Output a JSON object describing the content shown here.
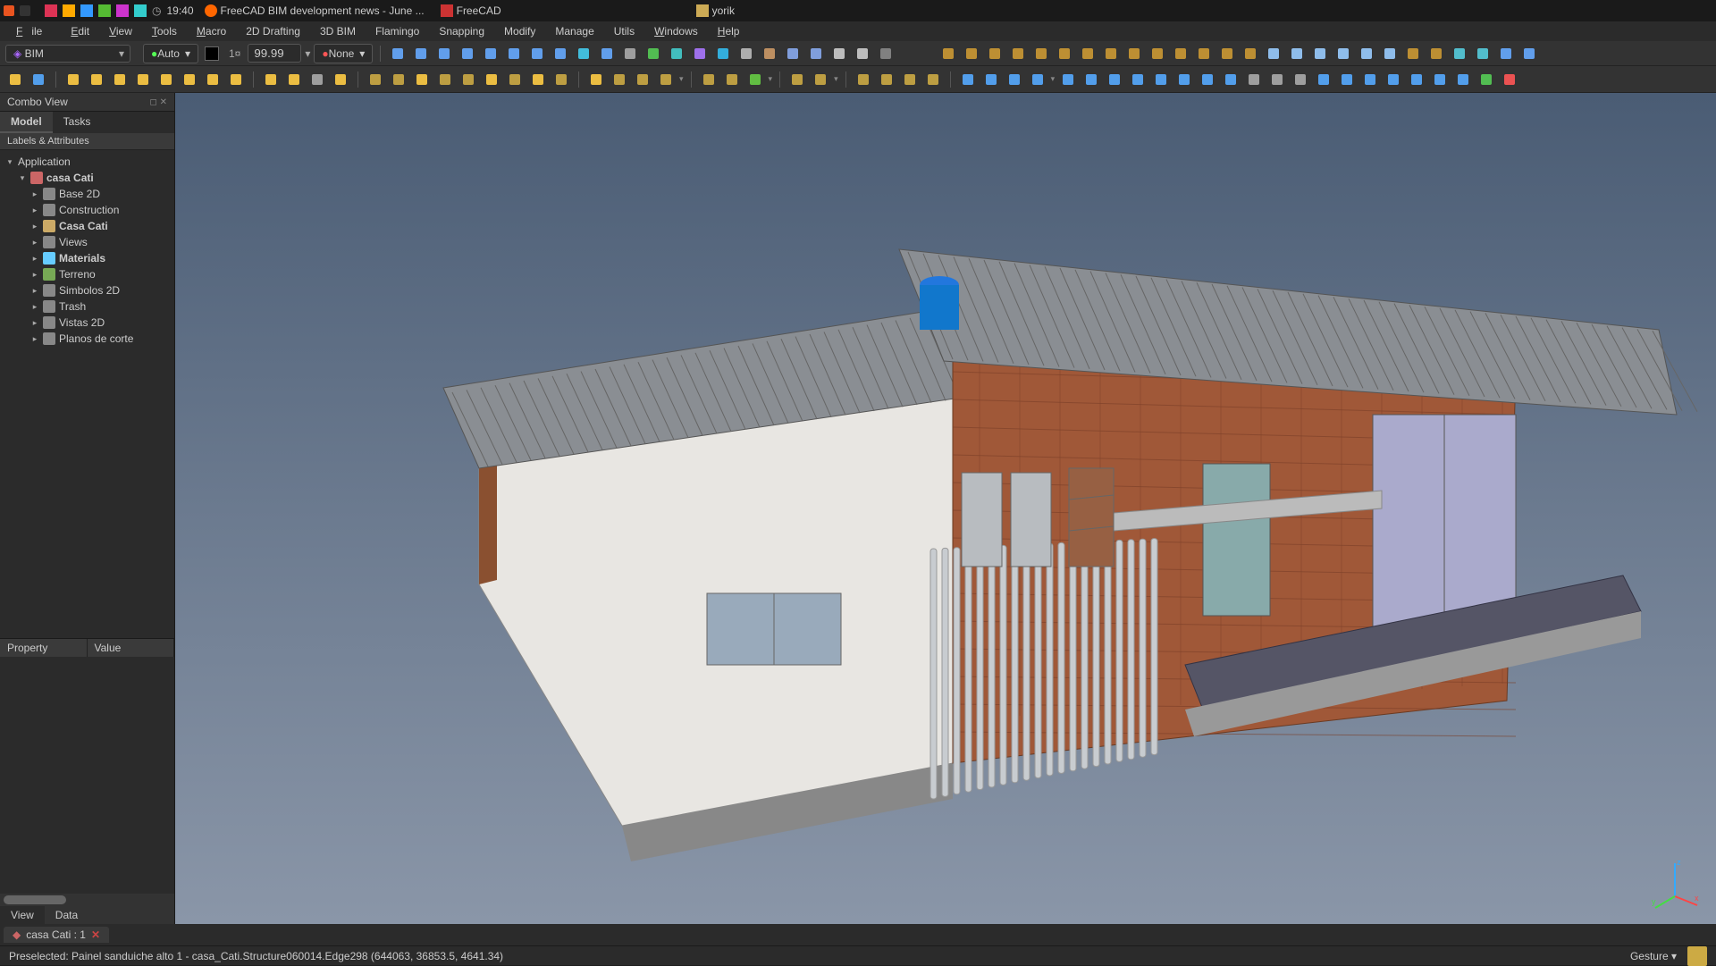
{
  "titlebar": {
    "time": "19:40",
    "tabs": [
      {
        "icon": "firefox",
        "label": "FreeCAD BIM development news - June ..."
      },
      {
        "icon": "freecad",
        "label": "FreeCAD"
      },
      {
        "icon": "folder",
        "label": "yorik"
      }
    ]
  },
  "menubar": [
    "File",
    "Edit",
    "View",
    "Tools",
    "Macro",
    "2D Drafting",
    "3D BIM",
    "Flamingo",
    "Snapping",
    "Modify",
    "Manage",
    "Utils",
    "Windows",
    "Help"
  ],
  "toolbar1": {
    "workbench": "BIM",
    "auto": "Auto",
    "precision": "99.99",
    "none": "None"
  },
  "combo_view": {
    "title": "Combo View",
    "tabs": [
      "Model",
      "Tasks"
    ],
    "active_tab": 0,
    "section": "Labels & Attributes",
    "root": "Application",
    "tree": [
      {
        "label": "casa Cati",
        "depth": 1,
        "expanded": true,
        "icon": "doc",
        "bold": true
      },
      {
        "label": "Base 2D",
        "depth": 2,
        "expanded": false,
        "icon": "folder"
      },
      {
        "label": "Construction",
        "depth": 2,
        "expanded": false,
        "icon": "folder"
      },
      {
        "label": "Casa Cati",
        "depth": 2,
        "expanded": false,
        "icon": "building",
        "bold": true
      },
      {
        "label": "Views",
        "depth": 2,
        "expanded": false,
        "icon": "folder"
      },
      {
        "label": "Materials",
        "depth": 2,
        "expanded": false,
        "icon": "material",
        "bold": true
      },
      {
        "label": "Terreno",
        "depth": 2,
        "expanded": false,
        "icon": "terrain"
      },
      {
        "label": "Simbolos 2D",
        "depth": 2,
        "expanded": false,
        "icon": "folder"
      },
      {
        "label": "Trash",
        "depth": 2,
        "expanded": false,
        "icon": "folder"
      },
      {
        "label": "Vistas 2D",
        "depth": 2,
        "expanded": false,
        "icon": "folder"
      },
      {
        "label": "Planos de corte",
        "depth": 2,
        "expanded": false,
        "icon": "folder"
      }
    ],
    "prop_headers": [
      "Property",
      "Value"
    ],
    "prop_tabs": [
      "View",
      "Data"
    ]
  },
  "doc_tab": {
    "label": "casa Cati : 1"
  },
  "statusbar": {
    "message": "Preselected: Painel sanduiche alto 1 - casa_Cati.Structure060014.Edge298 (644063, 36853.5, 4641.34)",
    "nav_mode": "Gesture"
  },
  "toolbar_icons_row1": [
    "grid",
    "axis",
    "workplane",
    "cube-view",
    "top-view",
    "front-view",
    "side-view",
    "iso-view",
    "globe",
    "circ",
    "cross-small",
    "fit-all",
    "section-box",
    "layer",
    "color-fill",
    "wrench",
    "package",
    "stack",
    "grid2",
    "file-alt",
    "save-alt",
    "toggle",
    "blank",
    "blank",
    "snap-end",
    "snap-mid",
    "snap-cen",
    "snap-ang",
    "snap-int",
    "snap-perp",
    "snap-ext",
    "snap-par",
    "snap-spec",
    "snap-near",
    "snap-ortho",
    "snap-grid",
    "snap-wp",
    "snap-dim",
    "guide1",
    "guide2",
    "guide3",
    "guide4",
    "guide5",
    "guide6",
    "ruler",
    "ruler2",
    "angle-snap",
    "grid-toggle",
    "clip1",
    "clip2"
  ],
  "toolbar_icons_row2": [
    "new-file",
    "open-file",
    "sep",
    "line",
    "wire",
    "circle",
    "arc",
    "ellipse",
    "polygon",
    "rect",
    "point",
    "sep",
    "text-a",
    "text-s",
    "dim",
    "leader",
    "sep",
    "cube-gold",
    "wall",
    "beam",
    "slab",
    "panel",
    "roof",
    "window",
    "stairs",
    "column",
    "sep",
    "circle2",
    "prism",
    "cyl",
    "sphere",
    "dd",
    "sep",
    "bars",
    "rebar1",
    "rebar2",
    "dd",
    "sep",
    "space",
    "material2",
    "dd",
    "sep",
    "box1",
    "box2",
    "box3",
    "ext",
    "sep",
    "move",
    "rotate",
    "undo",
    "redo",
    "dd",
    "mirror",
    "array",
    "copy",
    "link",
    "grid3",
    "offset",
    "trim",
    "scale",
    "del",
    "dup",
    "sel",
    "group",
    "ungroup",
    "hide",
    "show",
    "isolate",
    "measure",
    "check",
    "plus",
    "minus"
  ]
}
